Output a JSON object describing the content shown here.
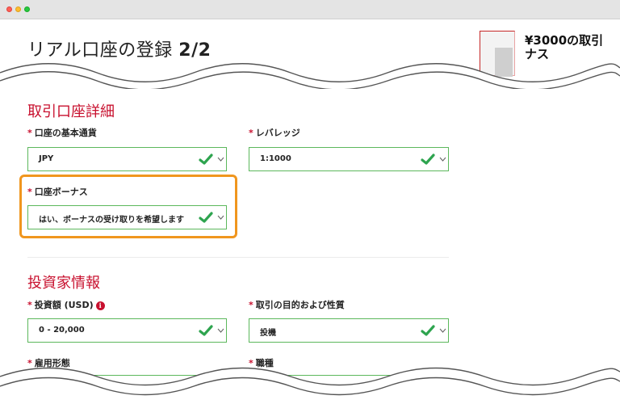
{
  "window": {
    "controls": [
      "close",
      "minimize",
      "maximize"
    ]
  },
  "header": {
    "title": "リアル口座の登録",
    "step": "2/2"
  },
  "bonus_card": {
    "text_line1": "¥3000の取引",
    "text_line2": "ナス"
  },
  "sections": {
    "account": {
      "title": "取引口座詳細",
      "currency": {
        "label": "口座の基本通貨",
        "value": "JPY"
      },
      "leverage": {
        "label": "レバレッジ",
        "value": "1:1000"
      },
      "bonus": {
        "label": "口座ボーナス",
        "value": "はい、ボーナスの受け取りを希望します"
      }
    },
    "investor": {
      "title": "投資家情報",
      "investment": {
        "label": "投資額 (USD)",
        "value": "0 - 20,000"
      },
      "purpose": {
        "label": "取引の目的および性質",
        "value": "投機"
      },
      "employment": {
        "label": "雇用形態"
      },
      "occupation": {
        "label": "職種"
      }
    }
  },
  "required_mark": "*",
  "colors": {
    "accent": "#c8102e",
    "valid_border": "#5cb85c",
    "check": "#2ea44f",
    "highlight": "#f0961e"
  },
  "icons": [
    "check-icon",
    "chevron-down-icon",
    "info-icon"
  ]
}
